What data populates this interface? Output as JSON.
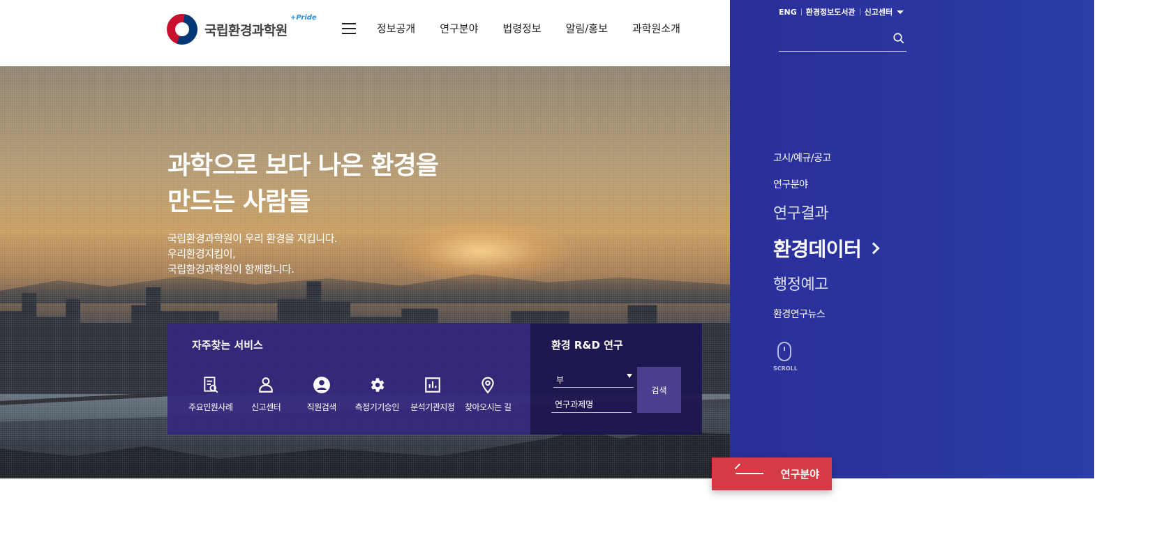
{
  "header": {
    "logo_text": "국립환경과학원",
    "logo_tag": "+Pride",
    "nav": [
      "정보공개",
      "연구분야",
      "법령정보",
      "알림/홍보",
      "과학원소개"
    ]
  },
  "hero": {
    "title_line1": "과학으로 보다 나은 환경을",
    "title_line2": "만드는 사람들",
    "desc_line1": "국립환경과학원이 우리 환경을 지킵니다.",
    "desc_line2": "우리환경지킴이,",
    "desc_line3": "국립환경과학원이 함께합니다."
  },
  "services": {
    "title": "자주찾는 서비스",
    "items": [
      {
        "label": "주요민원사례",
        "icon": "document-search-icon"
      },
      {
        "label": "신고센터",
        "icon": "person-icon"
      },
      {
        "label": "직원검색",
        "icon": "user-circle-icon"
      },
      {
        "label": "측정기기승인",
        "icon": "gear-icon"
      },
      {
        "label": "분석기관지정",
        "icon": "bar-chart-icon"
      },
      {
        "label": "찾아오시는 길",
        "icon": "map-pin-icon"
      }
    ]
  },
  "rnd": {
    "title": "환경 R&D 연구",
    "select_value": "부",
    "input_value": "연구과제명",
    "search_label": "검색"
  },
  "side": {
    "util": {
      "eng": "ENG",
      "library": "환경정보도서관",
      "report": "신고센터"
    },
    "menu": [
      "고시/예규/공고",
      "연구분야",
      "연구결과",
      "환경데이터",
      "행정예고",
      "환경연구뉴스"
    ],
    "scroll_label": "SCROLL"
  },
  "float_button": {
    "label": "연구분야"
  },
  "colors": {
    "panel_blue": "#2a36a0",
    "services_purple": "#34287d",
    "accent_red": "#d63a45"
  }
}
